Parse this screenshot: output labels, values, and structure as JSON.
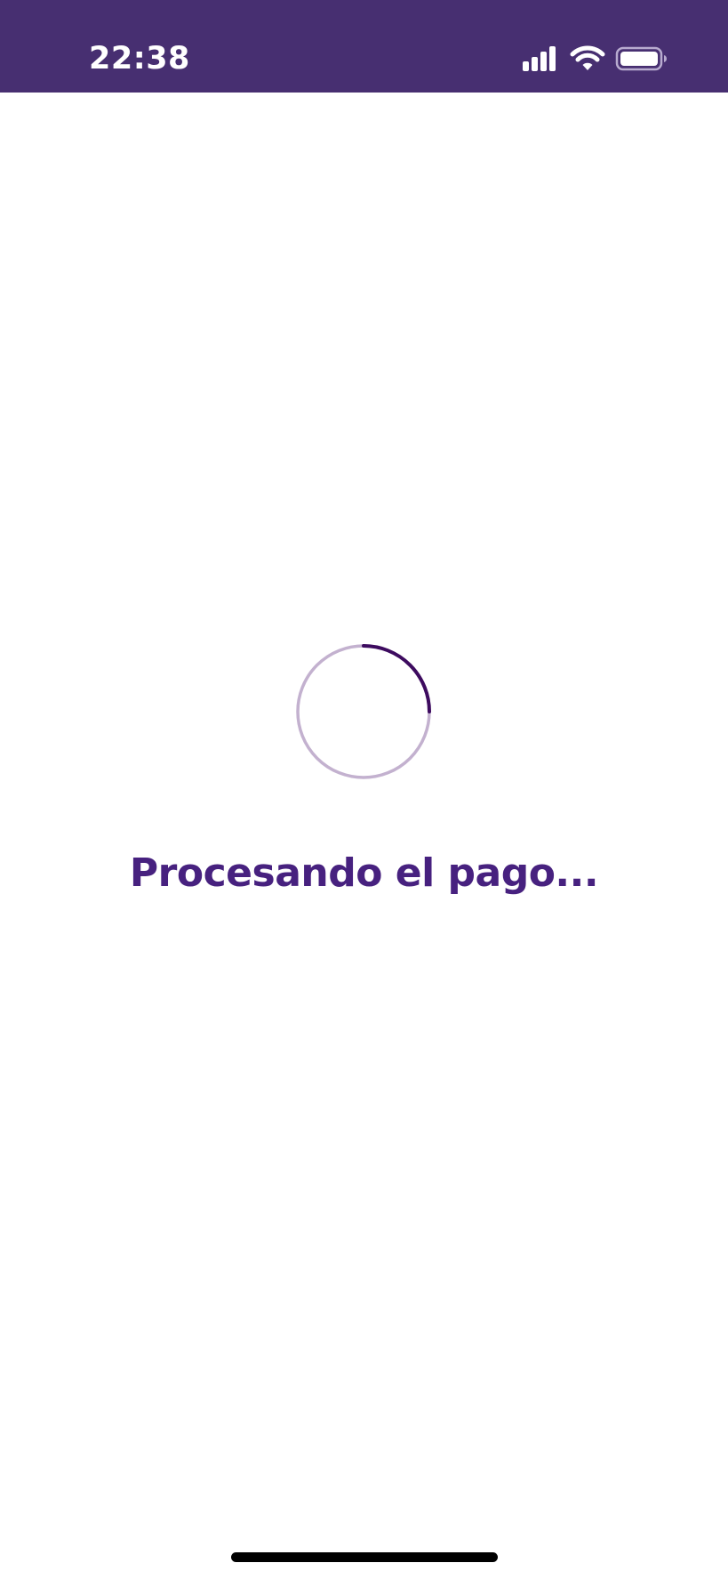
{
  "status_bar": {
    "time": "22:38",
    "signal_icon": "cellular-signal-icon",
    "wifi_icon": "wifi-icon",
    "battery_icon": "battery-full-icon"
  },
  "loader": {
    "icon": "loading-spinner-icon",
    "progress": 0.25
  },
  "main": {
    "title": "Procesando el pago..."
  },
  "colors": {
    "header_background": "#472f71",
    "accent": "#47217f",
    "spinner_track": "#c3b1cf",
    "spinner_arc": "#3d0b5f",
    "background": "#ffffff"
  }
}
